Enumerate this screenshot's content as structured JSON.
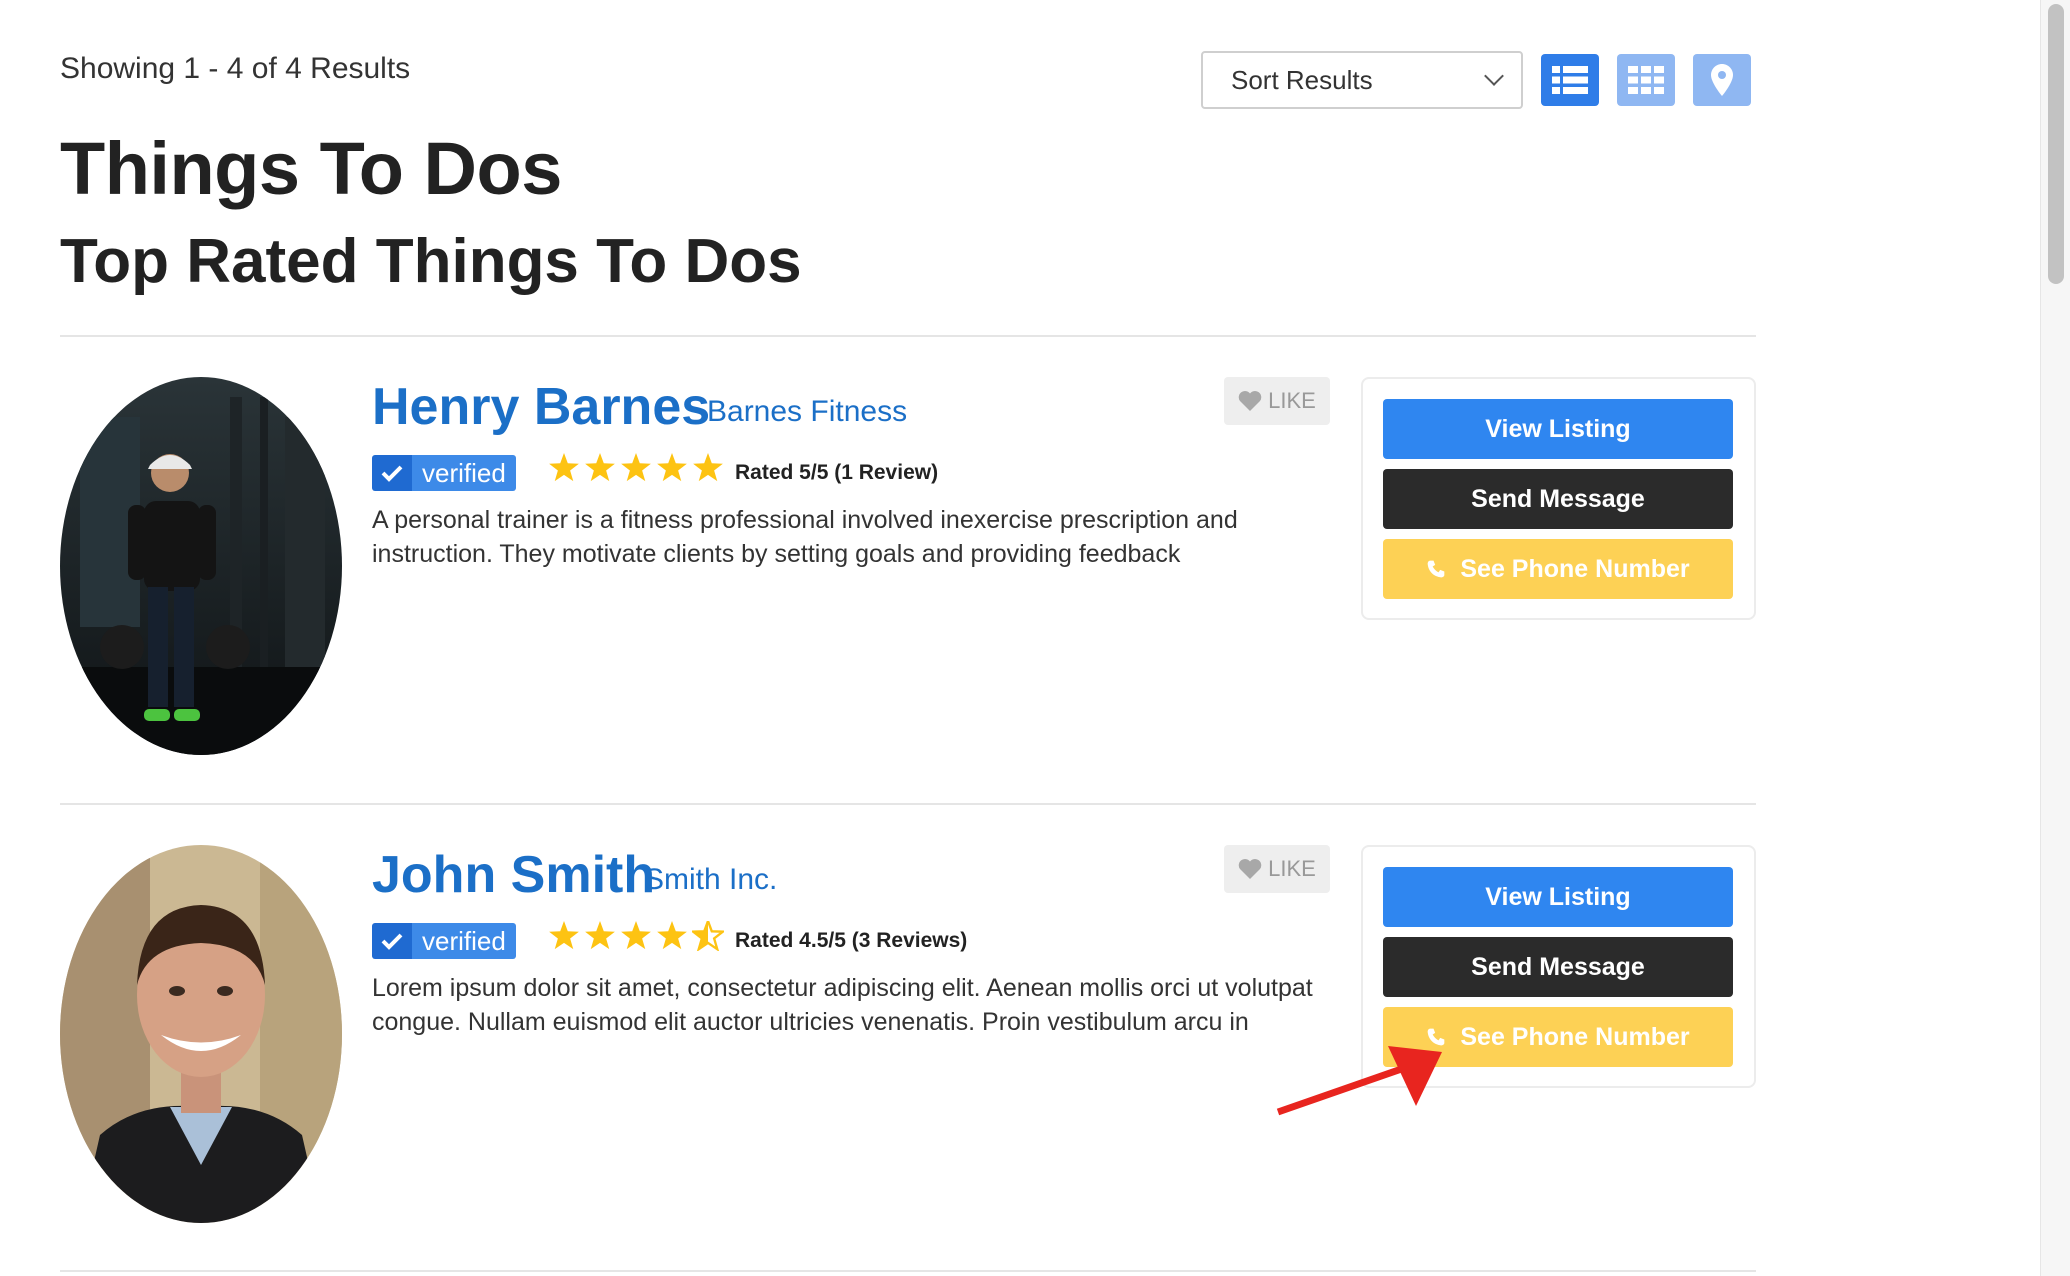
{
  "header": {
    "results_count": "Showing 1 - 4 of 4 Results",
    "sort_label": "Sort Results",
    "title": "Things To Dos",
    "subtitle": "Top Rated Things To Dos"
  },
  "view_modes": [
    "list-icon",
    "grid-icon",
    "map-pin-icon"
  ],
  "colors": {
    "link_blue": "#1b6fc7",
    "primary_button": "#2f86f0",
    "dark_button": "#2b2b2b",
    "phone_button": "#fdd155",
    "star": "#fdc312",
    "annotation_arrow": "#e8251f"
  },
  "listings": [
    {
      "name": "Henry Barnes",
      "company": "Barnes Fitness",
      "verified_label": "verified",
      "rating_value": 5,
      "rating_text": "Rated 5/5 (1 Review)",
      "description": "A personal trainer is a fitness professional involved inexercise prescription and instruction. They motivate clients by setting goals and providing feedback",
      "like_label": "LIKE",
      "view_label": "View Listing",
      "message_label": "Send Message",
      "phone_label": "See Phone Number"
    },
    {
      "name": "John Smith",
      "company": "Smith Inc.",
      "verified_label": "verified",
      "rating_value": 4.5,
      "rating_text": "Rated 4.5/5 (3 Reviews)",
      "description": "Lorem ipsum dolor sit amet, consectetur adipiscing elit. Aenean mollis orci ut volutpat congue. Nullam euismod elit auctor ultricies venenatis. Proin vestibulum arcu in",
      "like_label": "LIKE",
      "view_label": "View Listing",
      "message_label": "Send Message",
      "phone_label": "See Phone Number"
    }
  ]
}
